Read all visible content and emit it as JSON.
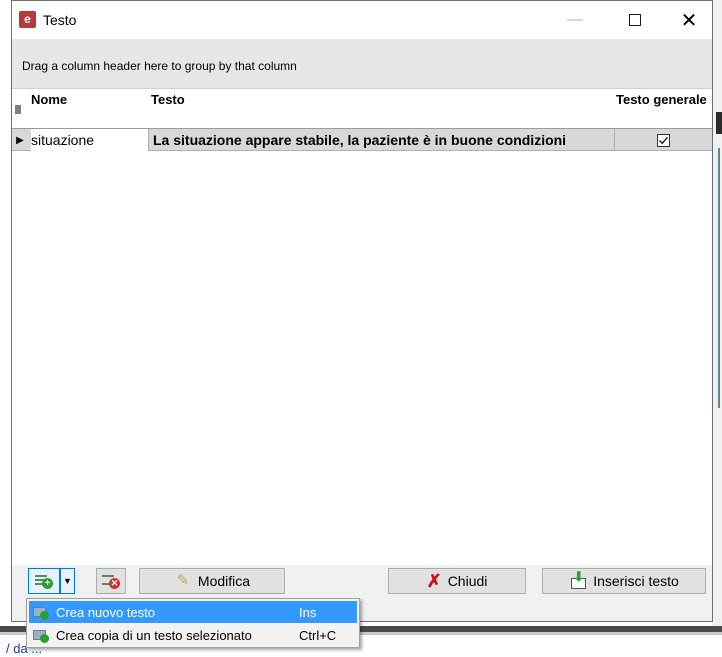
{
  "window": {
    "title": "Testo",
    "minimize_glyph": "—",
    "close_glyph": "✕"
  },
  "group_panel": {
    "hint": "Drag a column header here to group by that column"
  },
  "grid": {
    "columns": [
      "Nome",
      "Testo",
      "Testo generale"
    ],
    "rows": [
      {
        "nome": "situazione",
        "testo": "La situazione appare stabile, la paziente è in buone condizioni",
        "generale": true
      }
    ]
  },
  "toolbar": {
    "modifica_label": "Modifica",
    "chiudi_label": "Chiudi",
    "inserisci_label": "Inserisci testo"
  },
  "menu": {
    "items": [
      {
        "label": "Crea nuovo testo",
        "shortcut": "Ins"
      },
      {
        "label": "Crea copia di un testo selezionato",
        "shortcut": "Ctrl+C"
      }
    ]
  },
  "background": {
    "status_text": "/ da ..."
  },
  "colors": {
    "menu_highlight": "#3399ff",
    "row_selected": "#d8d8d8",
    "app_icon": "#b73a3a",
    "close_icon": "#d01010",
    "add_icon": "#2e9e2e"
  }
}
